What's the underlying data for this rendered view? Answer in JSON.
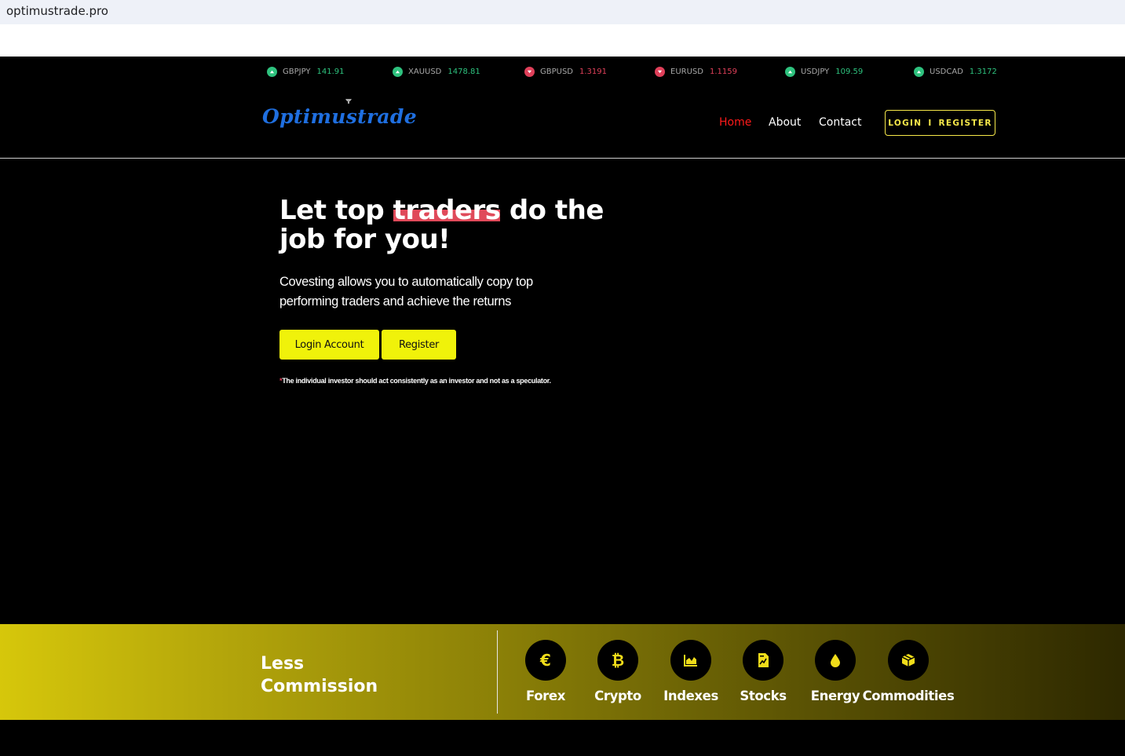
{
  "browser": {
    "url": "optimustrade.pro"
  },
  "ticker": [
    {
      "symbol": "GBPJPY",
      "value": "141.91",
      "direction": "up"
    },
    {
      "symbol": "XAUUSD",
      "value": "1478.81",
      "direction": "up"
    },
    {
      "symbol": "GBPUSD",
      "value": "1.3191",
      "direction": "down"
    },
    {
      "symbol": "EURUSD",
      "value": "1.1159",
      "direction": "down"
    },
    {
      "symbol": "USDJPY",
      "value": "109.59",
      "direction": "up"
    },
    {
      "symbol": "USDCAD",
      "value": "1.3172",
      "direction": "up"
    }
  ],
  "header": {
    "logo": "Optimustrade",
    "nav": {
      "home": "Home",
      "about": "About",
      "contact": "Contact"
    },
    "login": "LOGIN",
    "divider": "I",
    "register": "REGISTER"
  },
  "hero": {
    "title_pre": "Let top ",
    "title_highlight": "traders",
    "title_post": " do the job for you!",
    "subtitle": "Covesting allows you to automatically copy top performing traders and achieve the returns",
    "login_button": "Login Account",
    "register_button": "Register",
    "note_star": "*",
    "note": "The individual investor should act consistently as an investor and not as a speculator."
  },
  "band": {
    "title_line1": "Less",
    "title_line2": "Commission",
    "markets": [
      {
        "label": "Forex",
        "icon": "euro-icon",
        "glyph": "€"
      },
      {
        "label": "Crypto",
        "icon": "bitcoin-icon",
        "glyph": "₿"
      },
      {
        "label": "Indexes",
        "icon": "area-chart-icon"
      },
      {
        "label": "Stocks",
        "icon": "document-chart-icon"
      },
      {
        "label": "Energy",
        "icon": "drop-icon"
      },
      {
        "label": "Commodities",
        "icon": "box-icon"
      }
    ]
  },
  "colors": {
    "accent_yellow": "#f0f20a",
    "logo_blue": "#1f6fe0",
    "nav_active": "#ff1a1a",
    "ticker_up": "#2ec27e",
    "ticker_down": "#e0405a"
  }
}
